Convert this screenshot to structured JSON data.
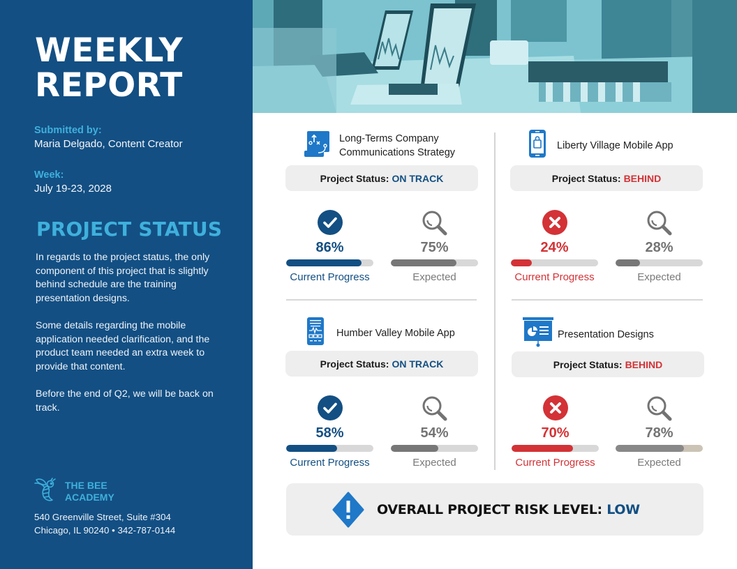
{
  "report": {
    "title_line1": "WEEKLY",
    "title_line2": "REPORT",
    "submitted_label": "Submitted by:",
    "submitted_value": "Maria Delgado, Content Creator",
    "week_label": "Week:",
    "week_value": "July 19-23, 2028"
  },
  "summary": {
    "heading": "PROJECT STATUS",
    "paragraphs": [
      "In regards to the project status, the only component of this project that is slightly behind schedule are the training presentation designs.",
      "Some details regarding the mobile application needed clarification, and the product team needed an extra week to provide that content.",
      "Before the end of Q2, we will be back on track."
    ]
  },
  "brand": {
    "name_line1": "THE BEE",
    "name_line2": "ACADEMY",
    "icon": "bee-icon",
    "address_line1": "540 Greenville Street, Suite #304",
    "address_line2": "Chicago, IL 90240 • 342-787-0144"
  },
  "colors": {
    "sidebar": "#134f83",
    "accent_cyan": "#3fb0dc",
    "on_track": "#134f83",
    "behind": "#d33236",
    "expected": "#737373",
    "icon_blue": "#1f78c8"
  },
  "status_prefix": "Project Status:",
  "current_label": "Current Progress",
  "expected_label": "Expected",
  "projects": [
    {
      "name_line1": "Long-Terms Company",
      "name_line2": "Communications Strategy",
      "icon": "strategy-board-icon",
      "status": "ON TRACK",
      "state": "ok",
      "current_pct": 86,
      "current_text": "86%",
      "expected_pct": 75,
      "expected_text": "75%"
    },
    {
      "name_line1": "Liberty Village Mobile App",
      "name_line2": "",
      "icon": "mobile-shopping-icon",
      "status": "BEHIND",
      "state": "behind",
      "current_pct": 24,
      "current_text": "24%",
      "expected_pct": 28,
      "expected_text": "28%"
    },
    {
      "name_line1": "Humber Valley Mobile App",
      "name_line2": "",
      "icon": "mobile-app-icon",
      "status": "ON TRACK",
      "state": "ok",
      "current_pct": 58,
      "current_text": "58%",
      "expected_pct": 54,
      "expected_text": "54%"
    },
    {
      "name_line1": "Presentation Designs",
      "name_line2": "",
      "icon": "presentation-board-icon",
      "status": "BEHIND",
      "state": "behind",
      "current_pct": 70,
      "current_text": "70%",
      "expected_pct": 78,
      "expected_text": "78%"
    }
  ],
  "risk": {
    "label": "OVERALL PROJECT RISK LEVEL:",
    "level": "LOW",
    "icon": "warning-diamond-icon"
  }
}
